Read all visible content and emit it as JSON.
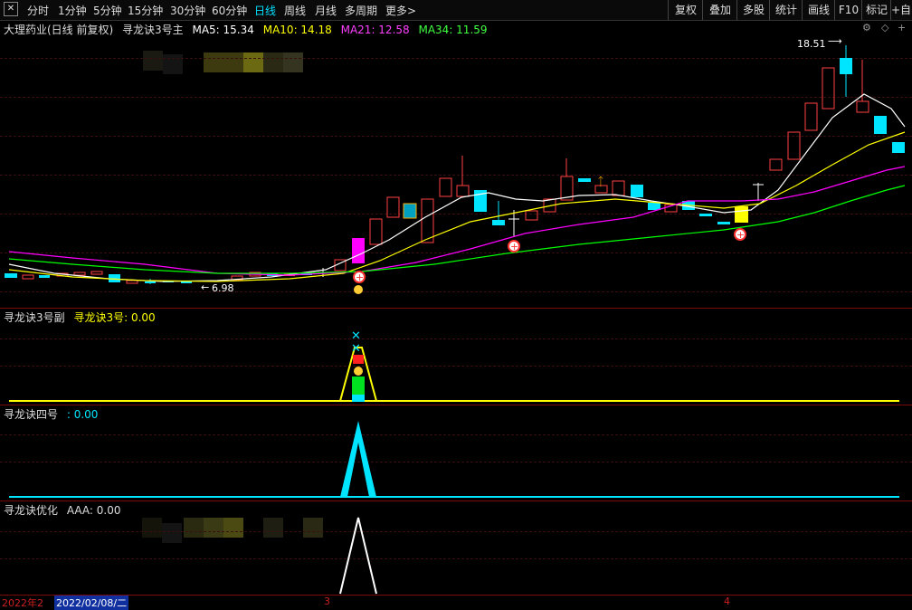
{
  "toolbar": {
    "close_icon": "close-icon",
    "periods": [
      "分时",
      "1分钟",
      "5分钟",
      "15分钟",
      "30分钟",
      "60分钟",
      "日线",
      "周线",
      "月线",
      "多周期",
      "更多>"
    ],
    "active_period": "日线",
    "right_buttons": [
      "复权",
      "叠加",
      "多股",
      "统计",
      "画线",
      "F10",
      "标记",
      "+自选"
    ]
  },
  "main_panel": {
    "stock_title": "大理药业(日线 前复权)",
    "indicator_name": "寻龙诀3号主",
    "ma5": "MA5: 15.34",
    "ma10": "MA10: 14.18",
    "ma21": "MA21: 12.58",
    "ma34": "MA34: 11.59",
    "high_label": "18.51",
    "low_label": "6.98",
    "colors": {
      "ma5": "#ffffff",
      "ma10": "#ffff00",
      "ma21": "#ff00ff",
      "ma34": "#00ff00",
      "up": "#ff4040",
      "down": "#00e5ff"
    }
  },
  "panel2": {
    "title": "寻龙诀3号副",
    "value_label": "寻龙诀3号: 0.00"
  },
  "panel3": {
    "title": "寻龙诀四号",
    "value_label": ": 0.00"
  },
  "panel4": {
    "title": "寻龙诀优化",
    "value_label": "AAA: 0.00"
  },
  "datebar": {
    "year_label": "2022年2",
    "cursor_date": "2022/02/08/二",
    "tick_3": "3",
    "tick_4": "4"
  }
}
